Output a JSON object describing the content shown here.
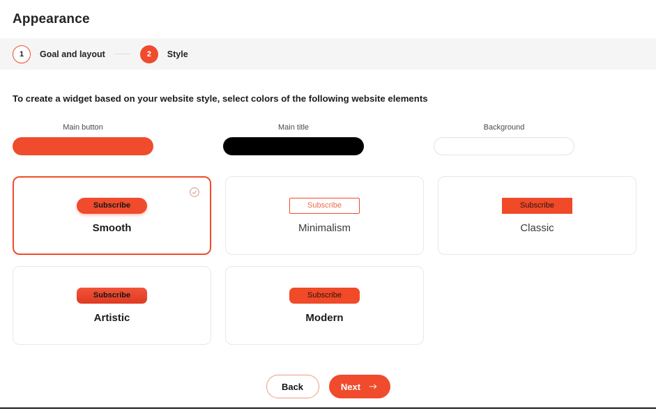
{
  "header": {
    "title": "Appearance"
  },
  "stepper": {
    "steps": [
      {
        "number": "1",
        "label": "Goal and layout",
        "state": "outline"
      },
      {
        "number": "2",
        "label": "Style",
        "state": "filled"
      }
    ]
  },
  "instruction": "To create a widget based on your website style, select colors of the following website elements",
  "colors": {
    "accent": "#ef4b2c",
    "title_color": "#000000",
    "background_color": "#ffffff",
    "swatches": [
      {
        "label": "Main button",
        "value": "#ef4b2c"
      },
      {
        "label": "Main title",
        "value": "#000000"
      },
      {
        "label": "Background",
        "value": "#ffffff"
      }
    ]
  },
  "styles": {
    "button_text": "Subscribe",
    "check_icon": "check-circle-icon",
    "cards": [
      {
        "name": "Smooth",
        "selected": true
      },
      {
        "name": "Minimalism",
        "selected": false
      },
      {
        "name": "Classic",
        "selected": false
      },
      {
        "name": "Artistic",
        "selected": false
      },
      {
        "name": "Modern",
        "selected": false
      }
    ]
  },
  "footer": {
    "back_label": "Back",
    "next_label": "Next",
    "next_icon": "arrow-right-icon"
  }
}
